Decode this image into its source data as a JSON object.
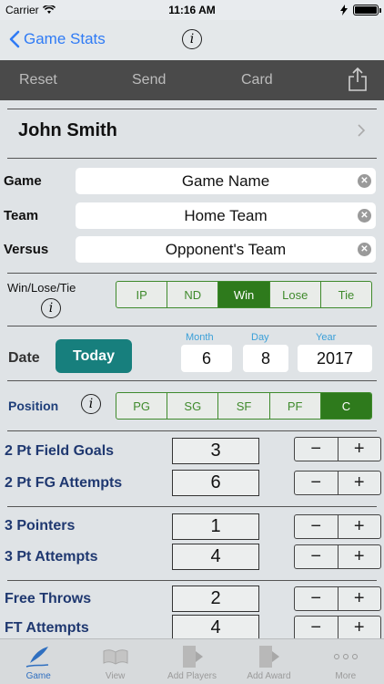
{
  "status_bar": {
    "carrier": "Carrier",
    "time": "11:16 AM"
  },
  "nav": {
    "back_label": "Game Stats",
    "info_icon": "info-circle-icon"
  },
  "toolbar": {
    "reset": "Reset",
    "send": "Send",
    "card": "Card",
    "share_icon": "share-icon"
  },
  "player": {
    "name": "John Smith"
  },
  "fields": [
    {
      "label": "Game",
      "value": "Game Name"
    },
    {
      "label": "Team",
      "value": "Home Team"
    },
    {
      "label": "Versus",
      "value": "Opponent's Team"
    }
  ],
  "result": {
    "label": "Win/Lose/Tie",
    "options": [
      "IP",
      "ND",
      "Win",
      "Lose",
      "Tie"
    ],
    "selected": "Win"
  },
  "date": {
    "label": "Date",
    "today_button": "Today",
    "month_caption": "Month",
    "day_caption": "Day",
    "year_caption": "Year",
    "month": "6",
    "day": "8",
    "year": "2017"
  },
  "position": {
    "label": "Position",
    "options": [
      "PG",
      "SG",
      "SF",
      "PF",
      "C"
    ],
    "selected": "C"
  },
  "stats": [
    {
      "label": "2 Pt Field Goals",
      "value": "3"
    },
    {
      "label": "2 Pt FG Attempts",
      "value": "6"
    },
    {
      "label": "3 Pointers",
      "value": "1"
    },
    {
      "label": "3 Pt Attempts",
      "value": "4"
    },
    {
      "label": "Free Throws",
      "value": "2"
    },
    {
      "label": "FT Attempts",
      "value": "4"
    }
  ],
  "stepper": {
    "minus": "−",
    "plus": "+"
  },
  "tabs": [
    {
      "label": "Game",
      "active": true
    },
    {
      "label": "View",
      "active": false
    },
    {
      "label": "Add Players",
      "active": false
    },
    {
      "label": "Add Award",
      "active": false
    },
    {
      "label": "More",
      "active": false
    }
  ],
  "colors": {
    "accent_blue": "#2f7bf5",
    "green": "#2e7a1c",
    "teal": "#177f7d",
    "stat_text": "#1f3870"
  }
}
